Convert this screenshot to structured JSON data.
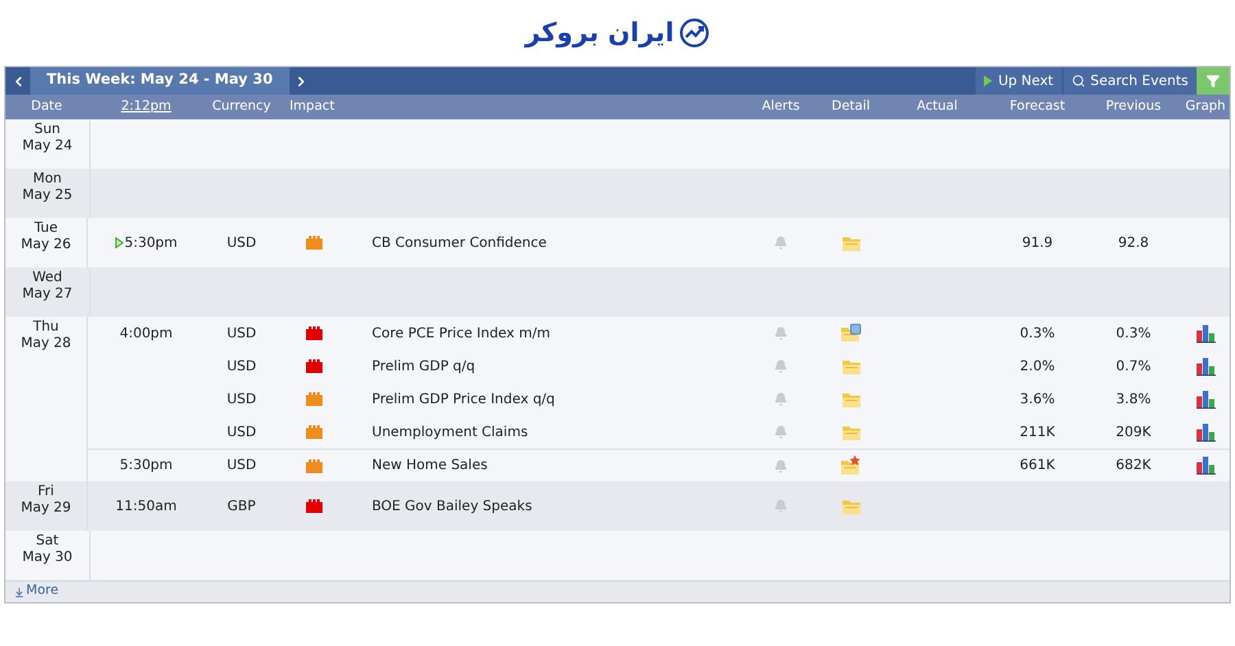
{
  "logo": {
    "text": "ایران بروکر"
  },
  "toolbar": {
    "week_label": "This Week: May 24 - May 30",
    "up_next": "Up Next",
    "search": "Search Events"
  },
  "columns": {
    "date": "Date",
    "time": "2:12pm",
    "currency": "Currency",
    "impact": "Impact",
    "alerts": "Alerts",
    "detail": "Detail",
    "actual": "Actual",
    "forecast": "Forecast",
    "previous": "Previous",
    "graph": "Graph"
  },
  "days": [
    {
      "weekday": "Sun",
      "date": "May 24"
    },
    {
      "weekday": "Mon",
      "date": "May 25"
    },
    {
      "weekday": "Tue",
      "date": "May 26",
      "events": [
        {
          "time": "5:30pm",
          "up_next": true,
          "currency": "USD",
          "color": "#f08c1e",
          "event": "CB Consumer Confidence",
          "kind": "plain",
          "forecast": "91.9",
          "previous": "92.8",
          "graph": false
        }
      ]
    },
    {
      "weekday": "Wed",
      "date": "May 27"
    },
    {
      "weekday": "Thu",
      "date": "May 28",
      "events": [
        {
          "time": "4:00pm",
          "up_next": false,
          "currency": "USD",
          "color": "#e30000",
          "event": "Core PCE Price Index m/m",
          "kind": "updated",
          "forecast": "0.3%",
          "previous": "0.3%",
          "graph": true
        },
        {
          "up_next": false,
          "currency": "USD",
          "color": "#e30000",
          "event": "Prelim GDP q/q",
          "kind": "plain",
          "forecast": "2.0%",
          "previous": "0.7%",
          "graph": true
        },
        {
          "up_next": false,
          "currency": "USD",
          "color": "#f08c1e",
          "event": "Prelim GDP Price Index q/q",
          "kind": "plain",
          "forecast": "3.6%",
          "previous": "3.8%",
          "graph": true
        },
        {
          "up_next": false,
          "currency": "USD",
          "color": "#f08c1e",
          "event": "Unemployment Claims",
          "kind": "plain",
          "forecast": "211K",
          "previous": "209K",
          "graph": true
        },
        {
          "time": "5:30pm",
          "up_next": false,
          "currency": "USD",
          "color": "#f08c1e",
          "event": "New Home Sales",
          "kind": "new",
          "forecast": "661K",
          "previous": "682K",
          "graph": true
        }
      ]
    },
    {
      "weekday": "Fri",
      "date": "May 29",
      "events": [
        {
          "time": "11:50am",
          "up_next": false,
          "currency": "GBP",
          "color": "#e30000",
          "event": "BOE Gov Bailey Speaks",
          "kind": "plain",
          "graph": false
        }
      ]
    },
    {
      "weekday": "Sat",
      "date": "May 30"
    }
  ],
  "more": "More"
}
